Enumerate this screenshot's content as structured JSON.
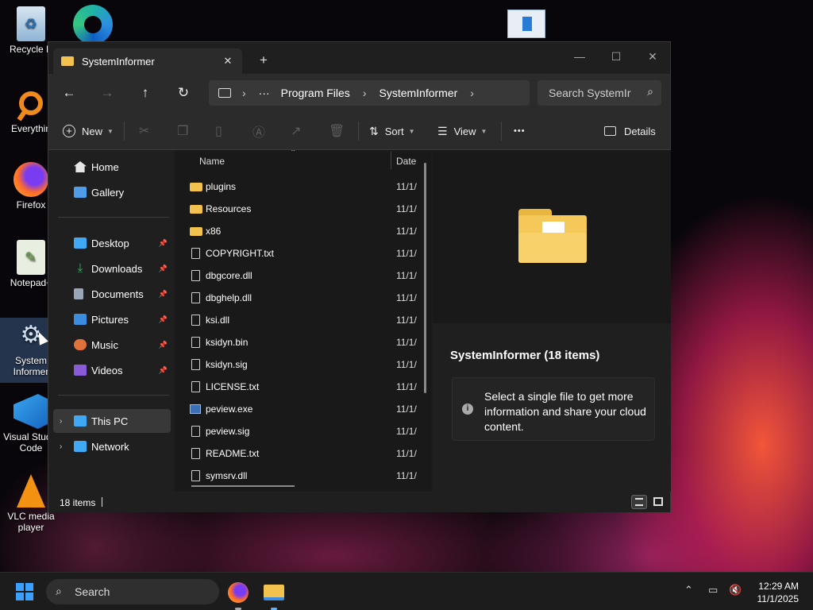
{
  "desktop": {
    "icons": [
      {
        "label": "Recycle B",
        "icon": "recycle-bin-icon"
      },
      {
        "label": "Everythin",
        "icon": "everything-icon"
      },
      {
        "label": "Firefox",
        "icon": "firefox-icon"
      },
      {
        "label": "Notepad+",
        "icon": "notepad-plus-icon"
      },
      {
        "label": "System Informer",
        "icon": "system-informer-icon"
      },
      {
        "label": "Visual Studio Code",
        "icon": "vscode-icon"
      },
      {
        "label": "VLC media player",
        "icon": "vlc-icon"
      }
    ]
  },
  "window": {
    "tab_title": "SystemInformer",
    "new_tab": "+",
    "controls": {
      "minimize": "—",
      "maximize": "☐",
      "close": "✕"
    },
    "nav": {
      "back": "←",
      "forward": "→",
      "up": "↑",
      "refresh": "↻"
    },
    "breadcrumb": {
      "ellipsis": "···",
      "items": [
        "Program Files",
        "SystemInformer"
      ],
      "sep": "›"
    },
    "search_placeholder": "Search SystemIr",
    "toolbar": {
      "new": "New",
      "sort": "Sort",
      "view": "View",
      "more": "•••",
      "details": "Details"
    },
    "sidebar": [
      {
        "label": "Home",
        "icon": "home-icon",
        "color": "#e6e6e6"
      },
      {
        "label": "Gallery",
        "icon": "gallery-icon",
        "color": "#4f9de8"
      },
      {
        "label": "Desktop",
        "icon": "desktop-icon",
        "color": "#3fa9f5",
        "pinned": true
      },
      {
        "label": "Downloads",
        "icon": "downloads-icon",
        "color": "#3fb56a",
        "pinned": true
      },
      {
        "label": "Documents",
        "icon": "documents-icon",
        "color": "#9aa6b8",
        "pinned": true
      },
      {
        "label": "Pictures",
        "icon": "pictures-icon",
        "color": "#3b8de0",
        "pinned": true
      },
      {
        "label": "Music",
        "icon": "music-icon",
        "color": "#e0733b",
        "pinned": true
      },
      {
        "label": "Videos",
        "icon": "videos-icon",
        "color": "#8a5bd6",
        "pinned": true
      },
      {
        "label": "This PC",
        "icon": "this-pc-icon",
        "color": "#3fa9f5"
      },
      {
        "label": "Network",
        "icon": "network-icon",
        "color": "#3fa9f5"
      }
    ],
    "columns": {
      "name": "Name",
      "date": "Date"
    },
    "files": [
      {
        "name": "plugins",
        "type": "folder",
        "date": "11/1/"
      },
      {
        "name": "Resources",
        "type": "folder",
        "date": "11/1/"
      },
      {
        "name": "x86",
        "type": "folder",
        "date": "11/1/"
      },
      {
        "name": "COPYRIGHT.txt",
        "type": "file",
        "date": "11/1/"
      },
      {
        "name": "dbgcore.dll",
        "type": "file",
        "date": "11/1/"
      },
      {
        "name": "dbghelp.dll",
        "type": "file",
        "date": "11/1/"
      },
      {
        "name": "ksi.dll",
        "type": "file",
        "date": "11/1/"
      },
      {
        "name": "ksidyn.bin",
        "type": "file",
        "date": "11/1/"
      },
      {
        "name": "ksidyn.sig",
        "type": "file",
        "date": "11/1/"
      },
      {
        "name": "LICENSE.txt",
        "type": "file",
        "date": "11/1/"
      },
      {
        "name": "peview.exe",
        "type": "exe",
        "date": "11/1/"
      },
      {
        "name": "peview.sig",
        "type": "file",
        "date": "11/1/"
      },
      {
        "name": "README.txt",
        "type": "file",
        "date": "11/1/"
      },
      {
        "name": "symsrv.dll",
        "type": "file",
        "date": "11/1/"
      }
    ],
    "details_pane": {
      "title": "SystemInformer (18 items)",
      "message": "Select a single file to get more information and share your cloud content."
    },
    "status": {
      "count": "18 items"
    }
  },
  "taskbar": {
    "search": "Search",
    "time": "12:29 AM",
    "date": "11/1/2025"
  }
}
